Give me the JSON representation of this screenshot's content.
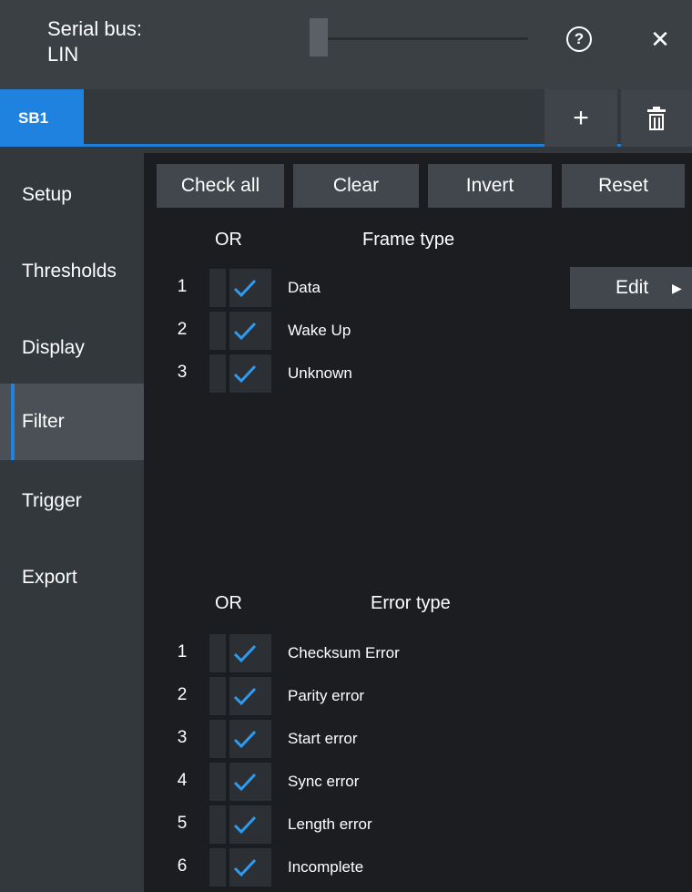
{
  "header": {
    "title_line1": "Serial bus:",
    "title_line2": "LIN",
    "help_glyph": "?",
    "close_glyph": "✕"
  },
  "tabs": {
    "active": "SB1",
    "add_glyph": "+"
  },
  "sidebar": {
    "items": [
      {
        "label": "Setup"
      },
      {
        "label": "Thresholds"
      },
      {
        "label": "Display"
      },
      {
        "label": "Filter",
        "active": true
      },
      {
        "label": "Trigger"
      },
      {
        "label": "Export"
      }
    ]
  },
  "actions": {
    "check_all": "Check all",
    "clear": "Clear",
    "invert": "Invert",
    "reset": "Reset"
  },
  "frame_section": {
    "or_label": "OR",
    "heading": "Frame type",
    "rows": [
      {
        "num": "1",
        "label": "Data",
        "checked": true
      },
      {
        "num": "2",
        "label": "Wake Up",
        "checked": true
      },
      {
        "num": "3",
        "label": "Unknown",
        "checked": true
      }
    ],
    "edit_label": "Edit",
    "edit_arrow": "▶"
  },
  "error_section": {
    "or_label": "OR",
    "heading": "Error type",
    "rows": [
      {
        "num": "1",
        "label": "Checksum Error",
        "checked": true
      },
      {
        "num": "2",
        "label": "Parity error",
        "checked": true
      },
      {
        "num": "3",
        "label": "Start error",
        "checked": true
      },
      {
        "num": "4",
        "label": "Sync error",
        "checked": true
      },
      {
        "num": "5",
        "label": "Length error",
        "checked": true
      },
      {
        "num": "6",
        "label": "Incomplete",
        "checked": true
      }
    ]
  },
  "colors": {
    "accent": "#1e82de",
    "check": "#2d9bf0"
  }
}
